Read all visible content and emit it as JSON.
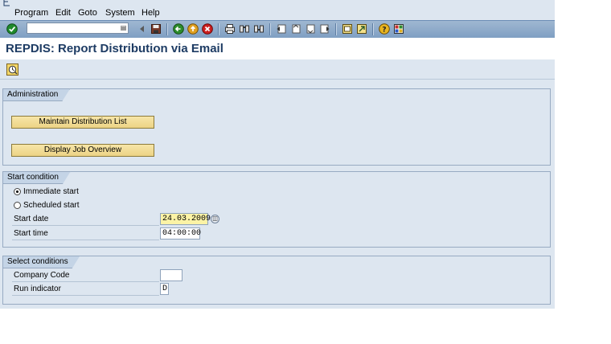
{
  "menu": {
    "items": [
      {
        "label": "Program"
      },
      {
        "label": "Edit"
      },
      {
        "label": "Goto"
      },
      {
        "label": "System"
      },
      {
        "label": "Help"
      }
    ]
  },
  "toolbar": {
    "command_field": {
      "value": "",
      "placeholder": ""
    },
    "icons": [
      "enter-icon",
      "back-icon",
      "save-icon",
      "back-green-icon",
      "exit-icon",
      "cancel-icon",
      "print-icon",
      "find-icon",
      "find-next-icon",
      "first-page-icon",
      "prev-page-icon",
      "next-page-icon",
      "last-page-icon",
      "create-session-icon",
      "shortcut-icon",
      "help-icon",
      "layout-icon"
    ]
  },
  "page": {
    "title": "REPDIS: Report Distribution via Email"
  },
  "apptoolbar": {
    "execute_icon": "execute-icon"
  },
  "administration": {
    "title": "Administration",
    "buttons": {
      "maintain": "Maintain Distribution List",
      "job_overview": "Display Job Overview"
    }
  },
  "start_condition": {
    "title": "Start condition",
    "immediate_label": "Immediate start",
    "scheduled_label": "Scheduled start",
    "immediate_selected": true,
    "start_date_label": "Start date",
    "start_date_value": "24.03.2009",
    "start_time_label": "Start time",
    "start_time_value": "04:00:00"
  },
  "select_conditions": {
    "title": "Select conditions",
    "company_code_label": "Company Code",
    "company_code_value": "",
    "run_indicator_label": "Run indicator",
    "run_indicator_value": "D"
  },
  "colors": {
    "background": "#dde6f0",
    "title": "#1e3c64",
    "button": "#ecd385",
    "required_field": "#fbf3a6"
  }
}
